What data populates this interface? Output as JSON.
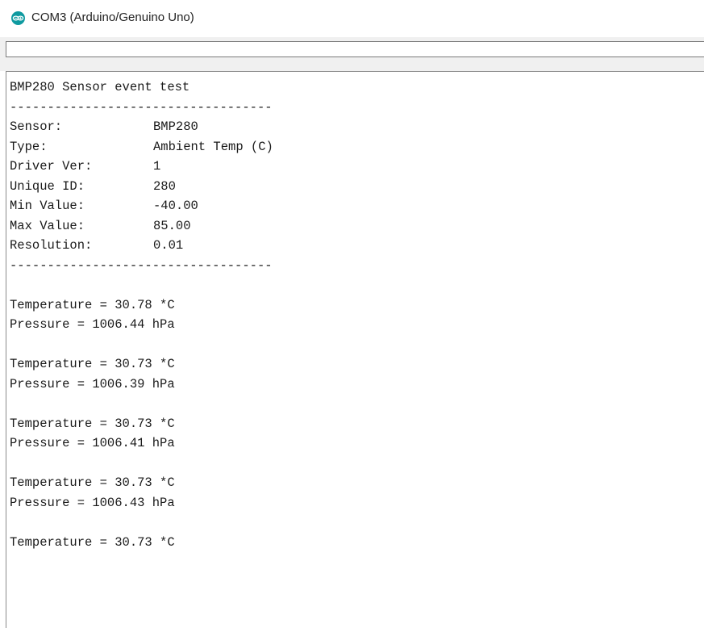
{
  "window": {
    "title": "COM3 (Arduino/Genuino Uno)",
    "icon": "arduino-icon",
    "accent_color": "#0f9aa0"
  },
  "send_input": {
    "value": ""
  },
  "output": {
    "header": "BMP280 Sensor event test",
    "separator": "-----------------------------------",
    "sensor_info": [
      {
        "key": "Sensor:",
        "value": "BMP280"
      },
      {
        "key": "Type:",
        "value": "Ambient Temp (C)"
      },
      {
        "key": "Driver Ver:",
        "value": "1"
      },
      {
        "key": "Unique ID:",
        "value": "280"
      },
      {
        "key": "Min Value:",
        "value": "-40.00"
      },
      {
        "key": "Max Value:",
        "value": "85.00"
      },
      {
        "key": "Resolution:",
        "value": "0.01"
      }
    ],
    "readings": [
      {
        "temperature": "Temperature = 30.78 *C",
        "pressure": "Pressure = 1006.44 hPa"
      },
      {
        "temperature": "Temperature = 30.73 *C",
        "pressure": "Pressure = 1006.39 hPa"
      },
      {
        "temperature": "Temperature = 30.73 *C",
        "pressure": "Pressure = 1006.41 hPa"
      },
      {
        "temperature": "Temperature = 30.73 *C",
        "pressure": "Pressure = 1006.43 hPa"
      },
      {
        "temperature": "Temperature = 30.73 *C",
        "pressure": ""
      }
    ]
  }
}
